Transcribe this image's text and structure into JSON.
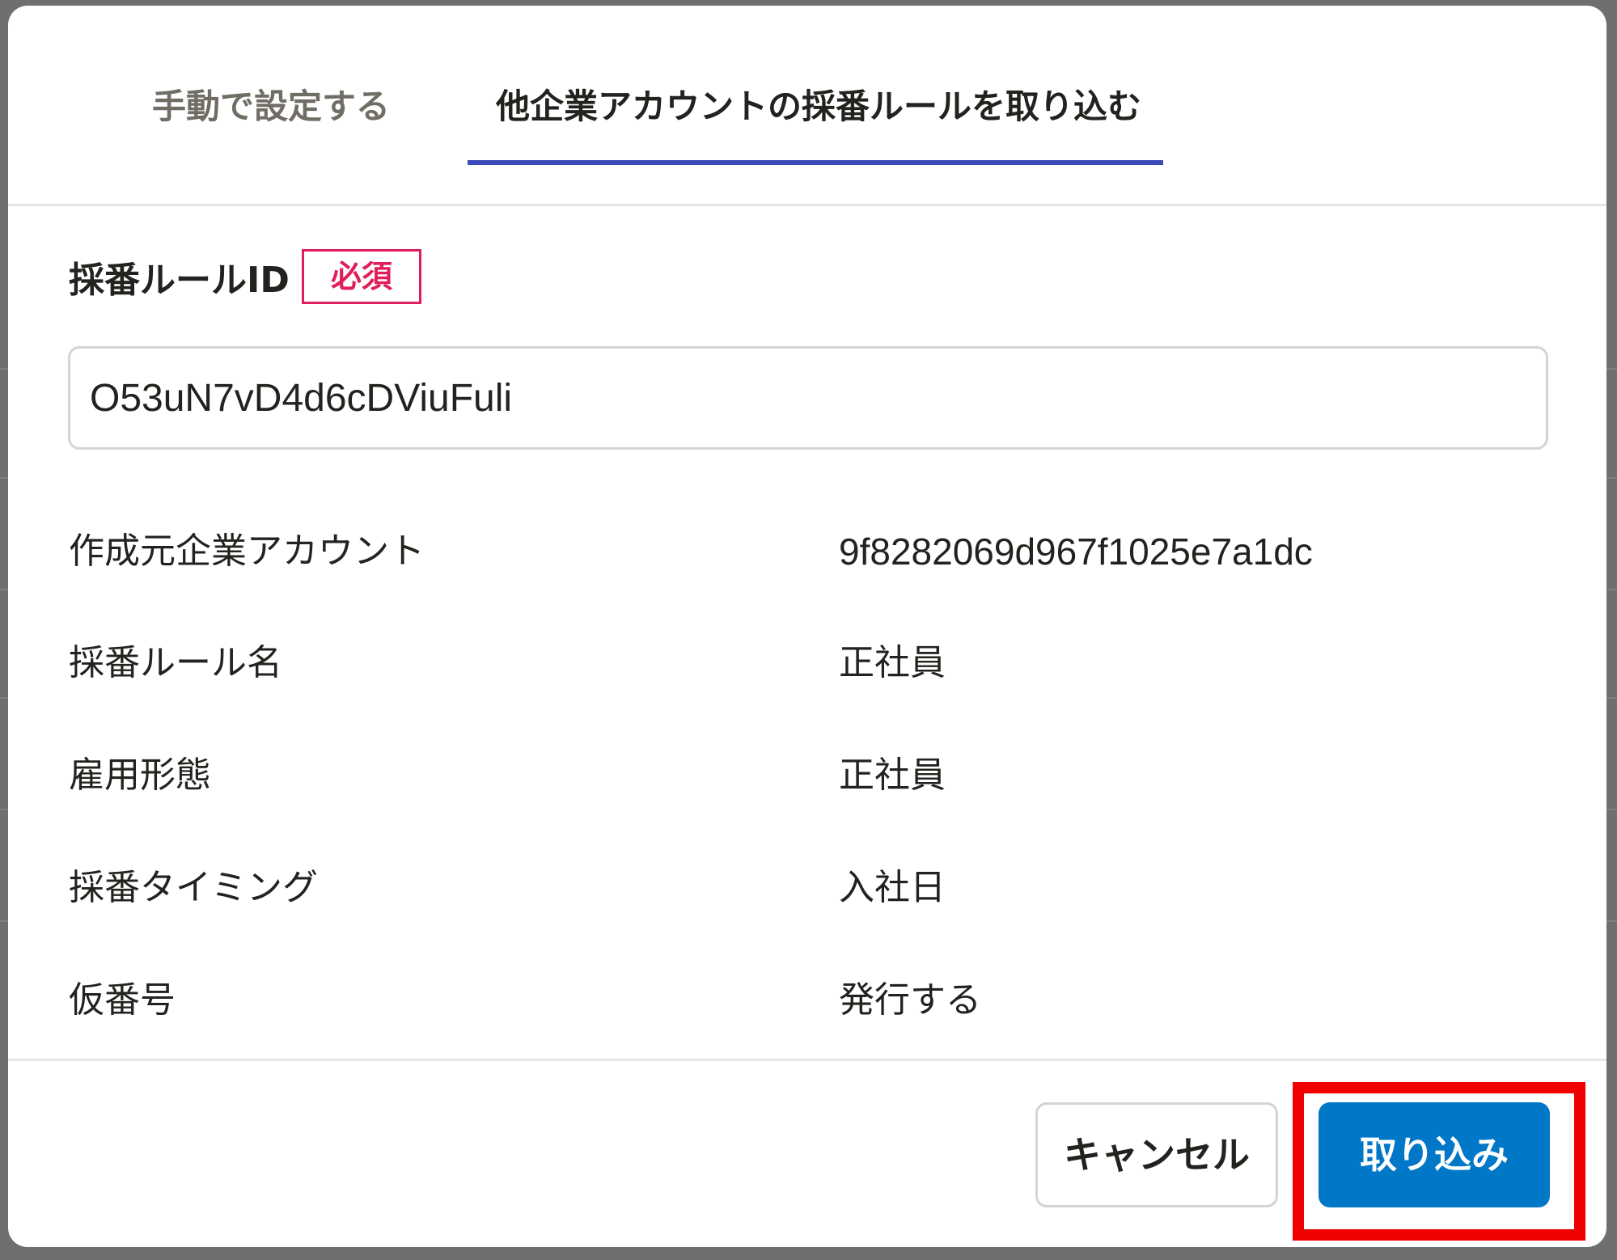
{
  "tabs": [
    {
      "label": "手動で設定する",
      "active": false
    },
    {
      "label": "他企業アカウントの採番ルールを取り込む",
      "active": true
    }
  ],
  "field": {
    "label": "採番ルールID",
    "required_badge": "必須",
    "value": "O53uN7vD4d6cDViuFuli"
  },
  "info_rows": [
    {
      "label": "作成元企業アカウント",
      "value": "9f8282069d967f1025e7a1dc"
    },
    {
      "label": "採番ルール名",
      "value": "正社員"
    },
    {
      "label": "雇用形態",
      "value": "正社員"
    },
    {
      "label": "採番タイミング",
      "value": "入社日"
    },
    {
      "label": "仮番号",
      "value": "発行する"
    }
  ],
  "footer": {
    "cancel_label": "キャンセル",
    "import_label": "取り込み"
  },
  "colors": {
    "tab_indicator": "#3d4bb8",
    "required": "#e01e5a",
    "primary_button": "#0077c7",
    "highlight": "#f00000"
  }
}
